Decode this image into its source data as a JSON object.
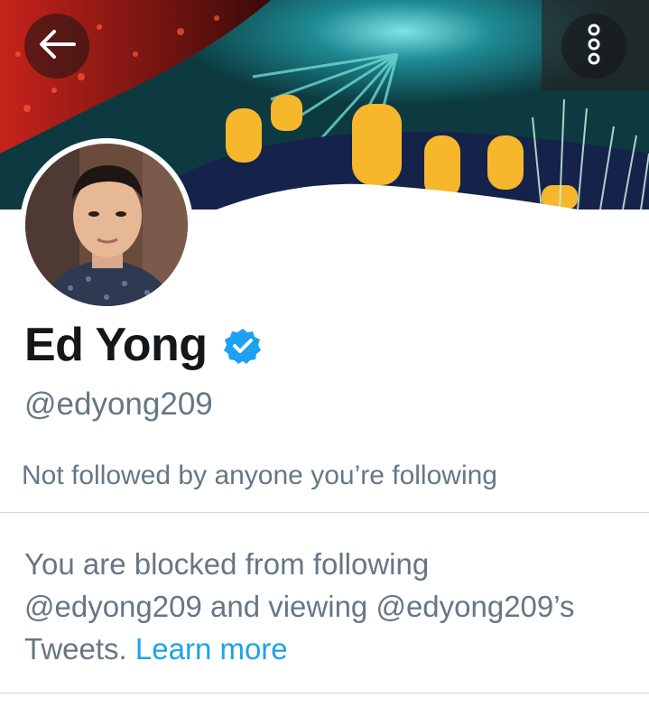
{
  "navigation": {
    "back_icon": "arrow-left-icon",
    "more_icon": "more-vertical-icon"
  },
  "profile": {
    "display_name": "Ed Yong",
    "verified": true,
    "verified_icon": "verified-badge-icon",
    "handle": "@edyong209",
    "followers_you_know": "Not followed by anyone you’re following"
  },
  "blocked_notice": {
    "line1": "You are blocked from following",
    "line2": "@edyong209 and viewing @edyong209’s",
    "line3_prefix": "Tweets.",
    "link_label": "Learn more"
  },
  "colors": {
    "accent": "#1da1f2",
    "secondary_text": "#657786",
    "primary_text": "#14171a",
    "divider": "#ccd6dd"
  }
}
